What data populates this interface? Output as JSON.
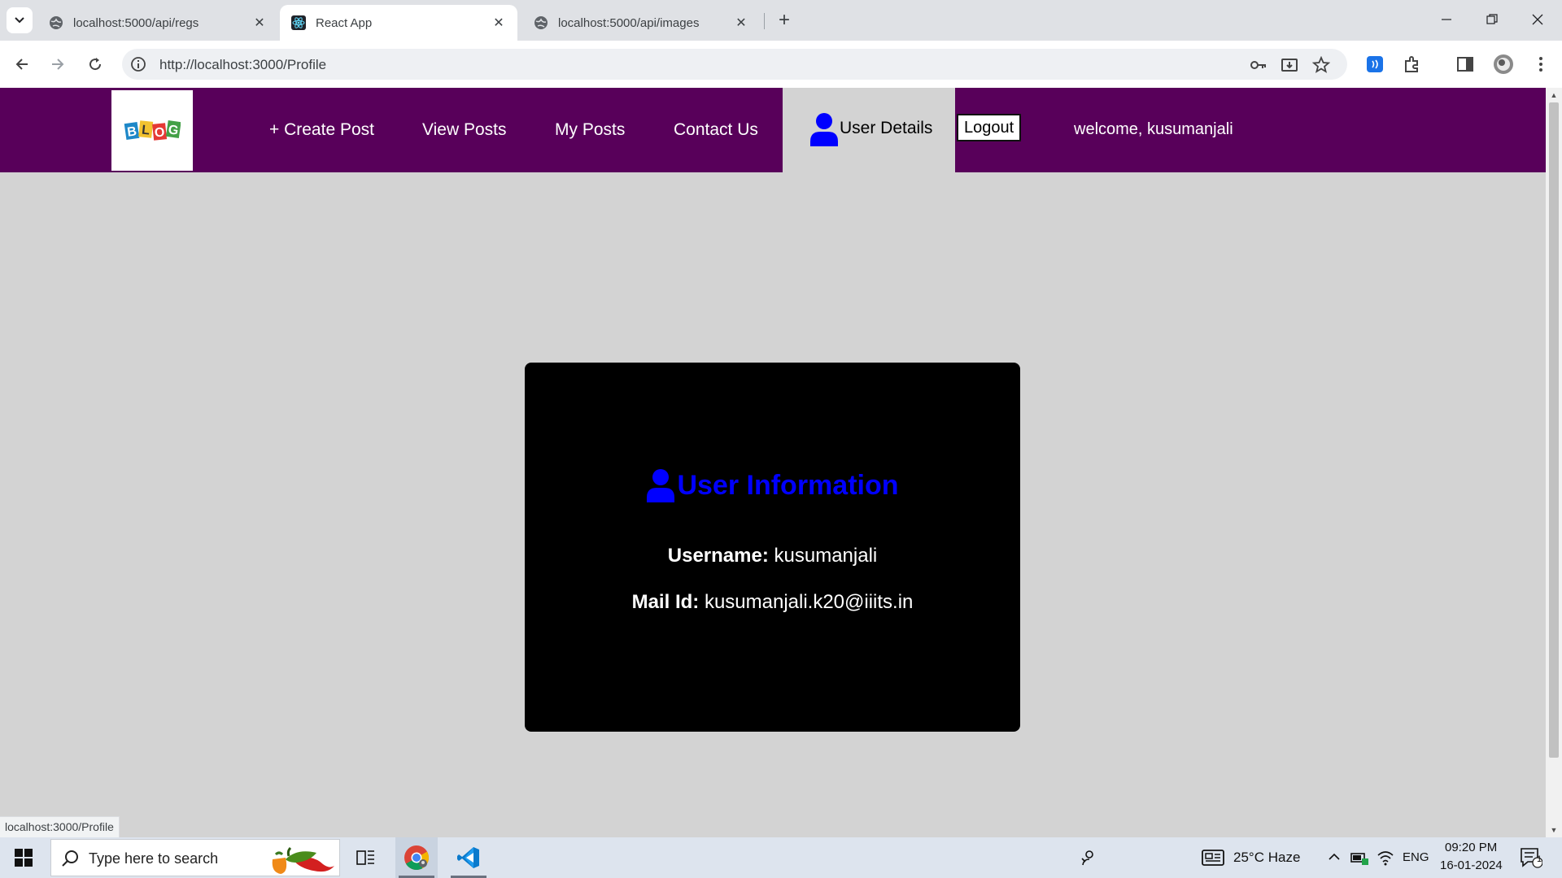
{
  "browser": {
    "tabs": [
      {
        "title": "localhost:5000/api/regs",
        "active": false
      },
      {
        "title": "React App",
        "active": true
      },
      {
        "title": "localhost:5000/api/images",
        "active": false
      }
    ],
    "url": "http://localhost:3000/Profile",
    "status_url": "localhost:3000/Profile"
  },
  "navbar": {
    "create_post": "+ Create Post",
    "view_posts": "View Posts",
    "my_posts": "My Posts",
    "contact_us": "Contact Us",
    "user_details": "User Details",
    "logout": "Logout",
    "welcome": "welcome, kusumanjali",
    "logo_letters": [
      "B",
      "L",
      "O",
      "G"
    ]
  },
  "profile": {
    "heading": "User Information",
    "username_label": "Username:",
    "username": "kusumanjali",
    "mail_label": "Mail Id:",
    "mail": "kusumanjali.k20@iiits.in"
  },
  "taskbar": {
    "search_placeholder": "Type here to search",
    "weather": "25°C  Haze",
    "language": "ENG",
    "time": "09:20 PM",
    "date": "16-01-2024",
    "notification_count": "1"
  },
  "colors": {
    "navbar_bg": "#58005a",
    "page_bg": "#d3d3d3",
    "card_bg": "#000000",
    "heading": "#0000ff"
  }
}
